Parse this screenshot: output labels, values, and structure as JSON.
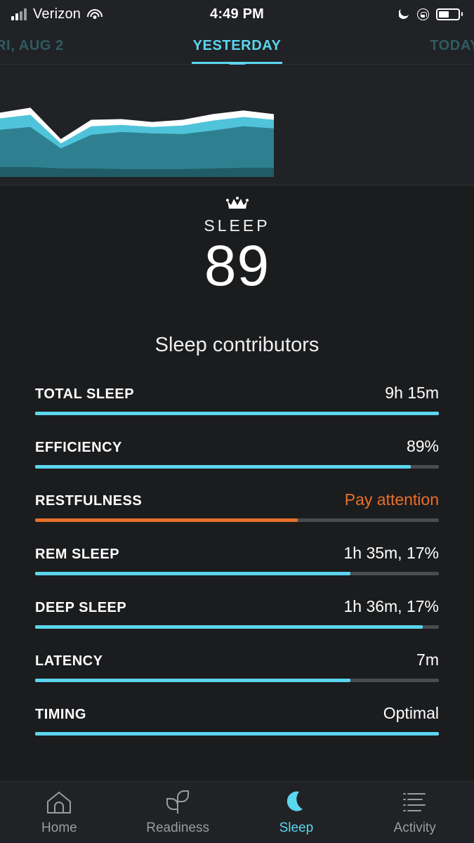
{
  "status_bar": {
    "carrier": "Verizon",
    "time": "4:49 PM",
    "signal_icon": "cellular-signal-icon",
    "wifi_icon": "wifi-icon",
    "dnd_icon": "moon-do-not-disturb-icon",
    "rotation_lock_icon": "rotation-lock-icon",
    "battery_icon": "battery-icon",
    "battery_level_pct": 52
  },
  "day_tabs": {
    "previous": "RI, AUG 2",
    "active": "YESTERDAY",
    "next": "TODAY",
    "accent_color": "#5BD6EF",
    "inactive_color": "#2f5b62"
  },
  "score": {
    "crown_icon": "crown-icon",
    "label": "SLEEP",
    "value": "89"
  },
  "contributors_title": "Sleep contributors",
  "contributors": [
    {
      "label": "TOTAL SLEEP",
      "value": "9h 15m",
      "fill_pct": 100,
      "status": "good"
    },
    {
      "label": "EFFICIENCY",
      "value": "89%",
      "fill_pct": 93,
      "status": "good"
    },
    {
      "label": "RESTFULNESS",
      "value": "Pay attention",
      "fill_pct": 65,
      "status": "warn"
    },
    {
      "label": "REM SLEEP",
      "value": "1h 35m, 17%",
      "fill_pct": 78,
      "status": "good"
    },
    {
      "label": "DEEP SLEEP",
      "value": "1h 36m, 17%",
      "fill_pct": 96,
      "status": "good"
    },
    {
      "label": "LATENCY",
      "value": "7m",
      "fill_pct": 78,
      "status": "good"
    },
    {
      "label": "TIMING",
      "value": "Optimal",
      "fill_pct": 100,
      "status": "good"
    }
  ],
  "colors": {
    "accent_cyan": "#5BD6EF",
    "warn_orange": "#E8702A",
    "track_gray": "#4a4c4f",
    "background": "#1b1c1e",
    "panel": "#212225"
  },
  "chart_data": {
    "type": "area",
    "title": "",
    "stacked": true,
    "grid": false,
    "legend": "none",
    "x": [
      0,
      1,
      2,
      3,
      4,
      5,
      6,
      7,
      8,
      9
    ],
    "series": [
      {
        "name": "Deep sleep",
        "color": "#1F5C68",
        "values": [
          14,
          14,
          12,
          12,
          11,
          11,
          11,
          12,
          13,
          13
        ]
      },
      {
        "name": "Light sleep",
        "color": "#2E8090",
        "values": [
          52,
          56,
          28,
          47,
          52,
          50,
          49,
          53,
          58,
          55
        ]
      },
      {
        "name": "REM sleep",
        "color": "#4FC3D9",
        "values": [
          16,
          17,
          7,
          12,
          10,
          9,
          12,
          14,
          13,
          12
        ]
      },
      {
        "name": "Awake",
        "color": "#FFFFFF",
        "values": [
          8,
          10,
          6,
          9,
          8,
          7,
          8,
          9,
          9,
          8
        ]
      }
    ],
    "ylabel": "",
    "xlabel": "",
    "ylim": [
      0,
      110
    ]
  },
  "bottom_nav": [
    {
      "label": "Home",
      "icon": "home-icon",
      "active": false
    },
    {
      "label": "Readiness",
      "icon": "plant-leaf-icon",
      "active": false
    },
    {
      "label": "Sleep",
      "icon": "moon-icon",
      "active": true
    },
    {
      "label": "Activity",
      "icon": "list-icon",
      "active": false
    }
  ]
}
